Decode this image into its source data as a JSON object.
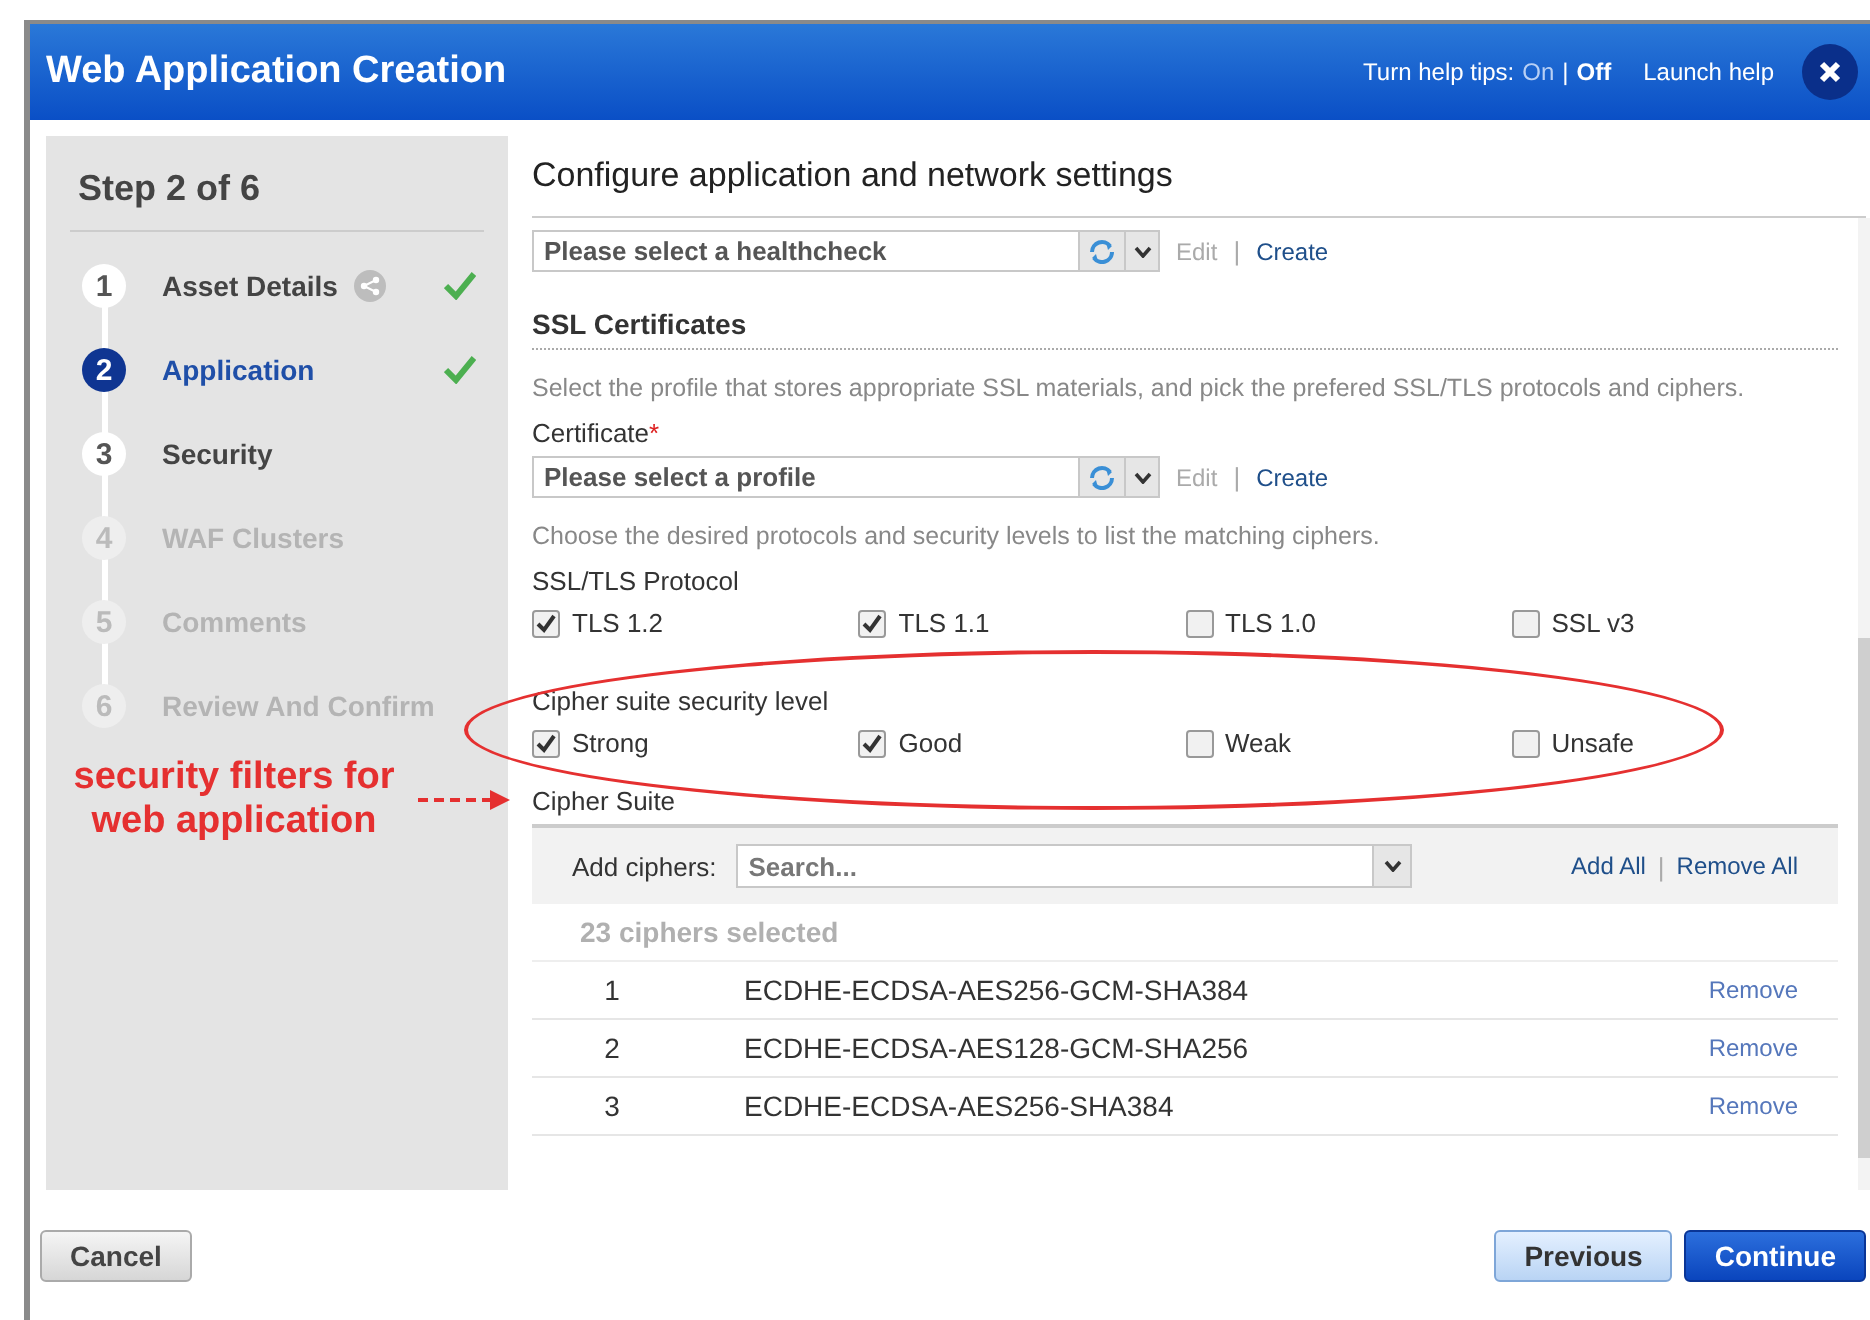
{
  "window": {
    "title": "Web Application Creation",
    "help_tips": {
      "label": "Turn help tips:",
      "separator": "|",
      "options": [
        {
          "label": "On",
          "selected": false
        },
        {
          "label": "Off",
          "selected": true
        }
      ]
    },
    "launch_help": "Launch help"
  },
  "wizard": {
    "step_title": "Step 2 of 6",
    "steps": [
      {
        "number": "1",
        "label": "Asset Details",
        "selected": false,
        "completed": true,
        "disabled": false,
        "shared_icon": true
      },
      {
        "number": "2",
        "label": "Application",
        "selected": true,
        "completed": true,
        "disabled": false,
        "shared_icon": false
      },
      {
        "number": "3",
        "label": "Security",
        "selected": false,
        "completed": false,
        "disabled": false,
        "shared_icon": false
      },
      {
        "number": "4",
        "label": "WAF Clusters",
        "selected": false,
        "completed": false,
        "disabled": true,
        "shared_icon": false
      },
      {
        "number": "5",
        "label": "Comments",
        "selected": false,
        "completed": false,
        "disabled": true,
        "shared_icon": false
      },
      {
        "number": "6",
        "label": "Review And Confirm",
        "selected": false,
        "completed": false,
        "disabled": true,
        "shared_icon": false
      }
    ]
  },
  "annotation": {
    "text": "security filters for web application"
  },
  "main": {
    "title": "Configure application and network settings",
    "healthcheck": {
      "value": "Please select a healthcheck",
      "edit": "Edit",
      "separator": "|",
      "create": "Create"
    },
    "ssl": {
      "heading": "SSL Certificates",
      "description": "Select the profile that stores appropriate SSL materials, and pick the prefered SSL/TLS protocols and ciphers.",
      "certificate": {
        "label": "Certificate",
        "required_mark": "*",
        "value": "Please select a profile",
        "edit": "Edit",
        "separator": "|",
        "create": "Create"
      },
      "protocol_hint": "Choose the desired protocols and security levels to list the matching ciphers.",
      "protocol_label": "SSL/TLS Protocol",
      "protocols": [
        {
          "label": "TLS 1.2",
          "checked": true
        },
        {
          "label": "TLS 1.1",
          "checked": true
        },
        {
          "label": "TLS 1.0",
          "checked": false
        },
        {
          "label": "SSL v3",
          "checked": false
        }
      ],
      "level_label": "Cipher suite security level",
      "levels": [
        {
          "label": "Strong",
          "checked": true
        },
        {
          "label": "Good",
          "checked": true
        },
        {
          "label": "Weak",
          "checked": false
        },
        {
          "label": "Unsafe",
          "checked": false
        }
      ],
      "suite_label": "Cipher Suite",
      "add_label": "Add ciphers:",
      "search_placeholder": "Search...",
      "add_all": "Add All",
      "links_separator": "|",
      "remove_all": "Remove All",
      "selected_count": "23 ciphers selected",
      "ciphers": [
        {
          "index": "1",
          "name": "ECDHE-ECDSA-AES256-GCM-SHA384",
          "action": "Remove"
        },
        {
          "index": "2",
          "name": "ECDHE-ECDSA-AES128-GCM-SHA256",
          "action": "Remove"
        },
        {
          "index": "3",
          "name": "ECDHE-ECDSA-AES256-SHA384",
          "action": "Remove"
        }
      ]
    }
  },
  "footer": {
    "cancel": "Cancel",
    "previous": "Previous",
    "continue": "Continue"
  }
}
